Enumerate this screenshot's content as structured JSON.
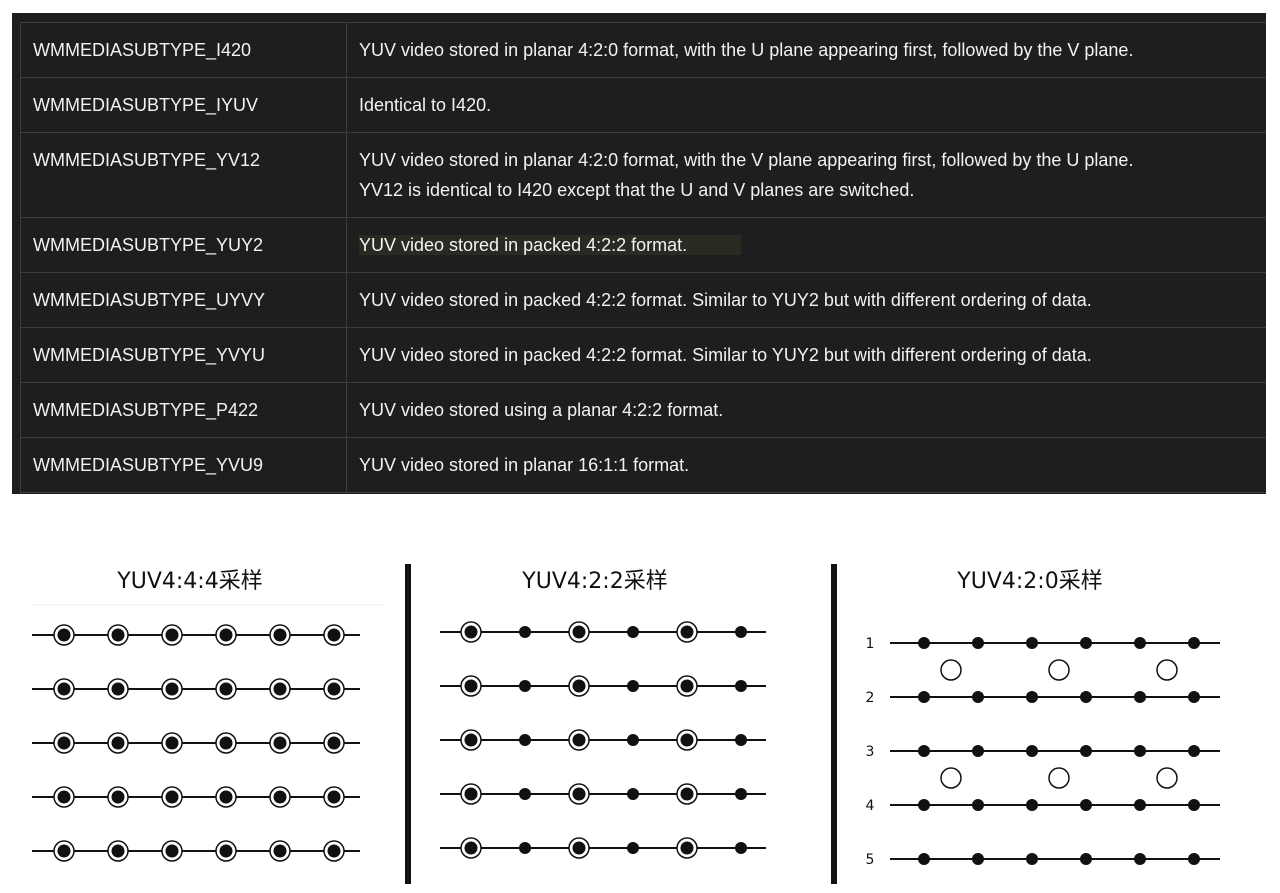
{
  "table": {
    "rows": [
      {
        "name": "WMMEDIASUBTYPE_I420",
        "desc": [
          "YUV video stored in planar 4:2:0 format, with the U plane appearing first, followed by the V plane."
        ]
      },
      {
        "name": "WMMEDIASUBTYPE_IYUV",
        "desc": [
          "Identical to I420."
        ]
      },
      {
        "name": "WMMEDIASUBTYPE_YV12",
        "desc": [
          "YUV video stored in planar 4:2:0 format, with the V plane appearing first, followed by the U plane.",
          "YV12 is identical to I420 except that the U and V planes are switched."
        ]
      },
      {
        "name": "WMMEDIASUBTYPE_YUY2",
        "desc": [
          "YUV video stored in packed 4:2:2 format."
        ],
        "highlighted": true
      },
      {
        "name": "WMMEDIASUBTYPE_UYVY",
        "desc": [
          "YUV video stored in packed 4:2:2 format. Similar to YUY2 but with different ordering of data."
        ]
      },
      {
        "name": "WMMEDIASUBTYPE_YVYU",
        "desc": [
          "YUV video stored in packed 4:2:2 format. Similar to YUY2 but with different ordering of data."
        ]
      },
      {
        "name": "WMMEDIASUBTYPE_P422",
        "desc": [
          "YUV video stored using a planar 4:2:2 format."
        ]
      },
      {
        "name": "WMMEDIASUBTYPE_YVU9",
        "desc": [
          "YUV video stored in planar 16:1:1 format."
        ]
      }
    ]
  },
  "colors": {
    "panel_bg": "#1e1e1e",
    "text": "#f2f2f2",
    "highlight_text": "#e6e08a",
    "grid": "#3d3d3d"
  },
  "diagrams": [
    {
      "title": "YUV4:4:4采样",
      "rows": 5,
      "cols": 6,
      "chroma": "every-sample"
    },
    {
      "title": "YUV4:2:2采样",
      "rows": 5,
      "cols": 6,
      "chroma": "every-other-sample"
    },
    {
      "title": "YUV4:2:0采样",
      "rows": 5,
      "cols": 6,
      "chroma": "between-row-pairs",
      "row_labels": [
        "1",
        "2",
        "3",
        "4",
        "5"
      ]
    }
  ]
}
